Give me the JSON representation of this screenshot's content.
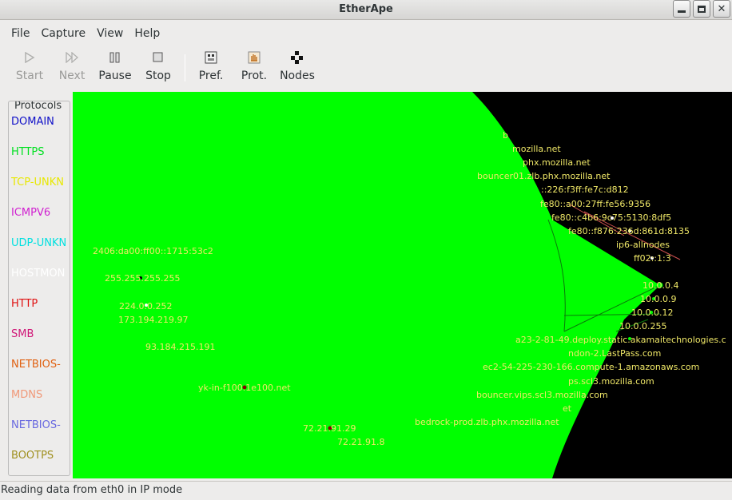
{
  "window": {
    "title": "EtherApe"
  },
  "menu": [
    "File",
    "Capture",
    "View",
    "Help"
  ],
  "toolbar": {
    "start": "Start",
    "next": "Next",
    "pause": "Pause",
    "stop": "Stop",
    "pref": "Pref.",
    "prot": "Prot.",
    "nodes": "Nodes"
  },
  "protocols": {
    "title": "Protocols",
    "items": [
      {
        "name": "DOMAIN",
        "color": "#1010c8"
      },
      {
        "name": "HTTPS",
        "color": "#00e020"
      },
      {
        "name": "TCP-UNKN",
        "color": "#e8e800"
      },
      {
        "name": "ICMPV6",
        "color": "#d020d0"
      },
      {
        "name": "UDP-UNKN",
        "color": "#00e0e0"
      },
      {
        "name": "HOSTMON",
        "color": "#ffffff"
      },
      {
        "name": "HTTP",
        "color": "#e01010"
      },
      {
        "name": "SMB",
        "color": "#d01878"
      },
      {
        "name": "NETBIOS-",
        "color": "#e06010"
      },
      {
        "name": "MDNS",
        "color": "#f09878"
      },
      {
        "name": "NETBIOS-",
        "color": "#6868e0"
      },
      {
        "name": "BOOTPS",
        "color": "#a09020"
      }
    ]
  },
  "colors": {
    "traffic": "#00ff00",
    "canvas_bg": "#000000",
    "node_label": "#f0e868"
  },
  "nodes": {
    "left": [
      "2406:da00:ff00::1715:53c2",
      "255.255.255.255",
      "224.0.0.252",
      "173.194.219.97",
      "93.184.215.191",
      "yk-in-f100.1e100.net",
      "72.21.91.29",
      "72.21.91.8"
    ],
    "right": [
      "b",
      "mozilla.net",
      "phx.mozilla.net",
      "bouncer01.zlb.phx.mozilla.net",
      "::226:f3ff:fe7c:d812",
      "fe80::a00:27ff:fe56:9356",
      "fe80::c4b6:9c75:5130:8df5",
      "fe80::f876:236d:861d:8135",
      "ip6-allnodes",
      "ff02::1:3",
      "10.0.0.4",
      "10.0.0.9",
      "10.0.0.12",
      "10.0.0.255",
      "a23-2-81-49.deploy.static.akamaitechnologies.c",
      "ndon-2.LastPass.com",
      "ec2-54-225-230-166.compute-1.amazonaws.com",
      "ps.scl3.mozilla.com",
      "bouncer.vips.scl3.mozilla.com",
      "et",
      "bedrock-prod.zlb.phx.mozilla.net"
    ]
  },
  "status": "Reading data from eth0 in IP mode"
}
